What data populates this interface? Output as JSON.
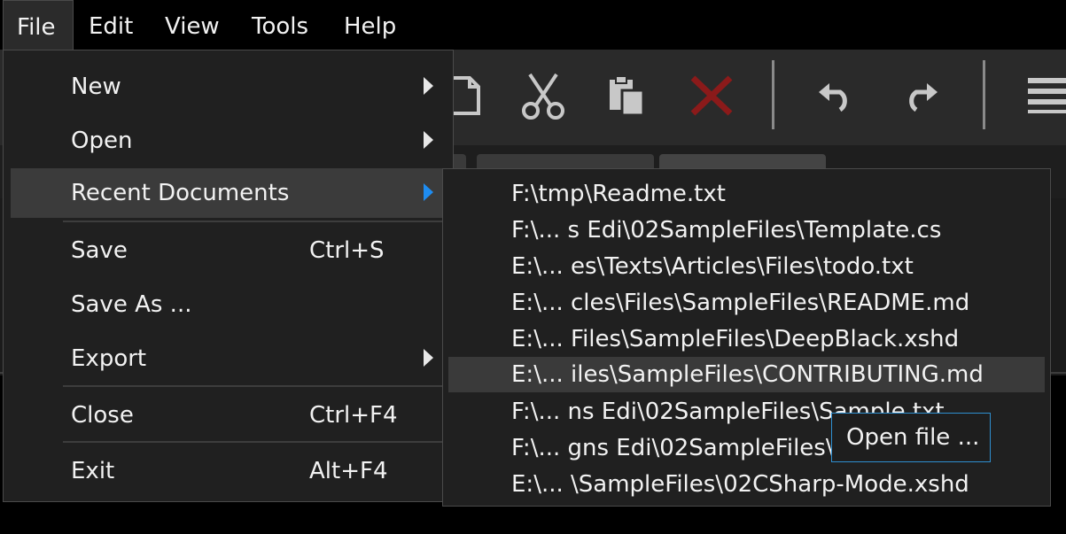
{
  "menubar": {
    "items": [
      {
        "label": "File",
        "active": true
      },
      {
        "label": "Edit"
      },
      {
        "label": "View"
      },
      {
        "label": "Tools"
      },
      {
        "label": "Help"
      }
    ]
  },
  "toolbar": {
    "icons": [
      "new-document-icon",
      "cut-icon",
      "paste-icon",
      "delete-icon",
      "undo-icon",
      "redo-icon",
      "hamburger-menu-icon"
    ],
    "colors": {
      "delete": "#8b1a1a",
      "icon": "#c8c8c8"
    }
  },
  "file_menu": {
    "items": [
      {
        "label": "New",
        "submenu": true
      },
      {
        "label": "Open",
        "submenu": true
      },
      {
        "label": "Recent Documents",
        "submenu": true,
        "highlighted": true
      },
      {
        "label": "Save",
        "shortcut": "Ctrl+S"
      },
      {
        "label": "Save As ..."
      },
      {
        "label": "Export",
        "submenu": true
      },
      {
        "label": "Close",
        "shortcut": "Ctrl+F4"
      },
      {
        "label": "Exit",
        "shortcut": "Alt+F4"
      }
    ]
  },
  "recent_documents": {
    "items": [
      "F:\\tmp\\Readme.txt",
      "F:\\... s Edi\\02SampleFiles\\Template.cs",
      "E:\\... es\\Texts\\Articles\\Files\\todo.txt",
      "E:\\... cles\\Files\\SampleFiles\\README.md",
      "E:\\... Files\\SampleFiles\\DeepBlack.xshd",
      "E:\\... iles\\SampleFiles\\CONTRIBUTING.md",
      "F:\\... ns Edi\\02SampleFiles\\Sample.txt",
      "F:\\... gns Edi\\02SampleFiles\\",
      "E:\\... \\SampleFiles\\02CSharp-Mode.xshd"
    ],
    "highlighted_index": 5
  },
  "tooltip": {
    "text": "Open file ..."
  }
}
